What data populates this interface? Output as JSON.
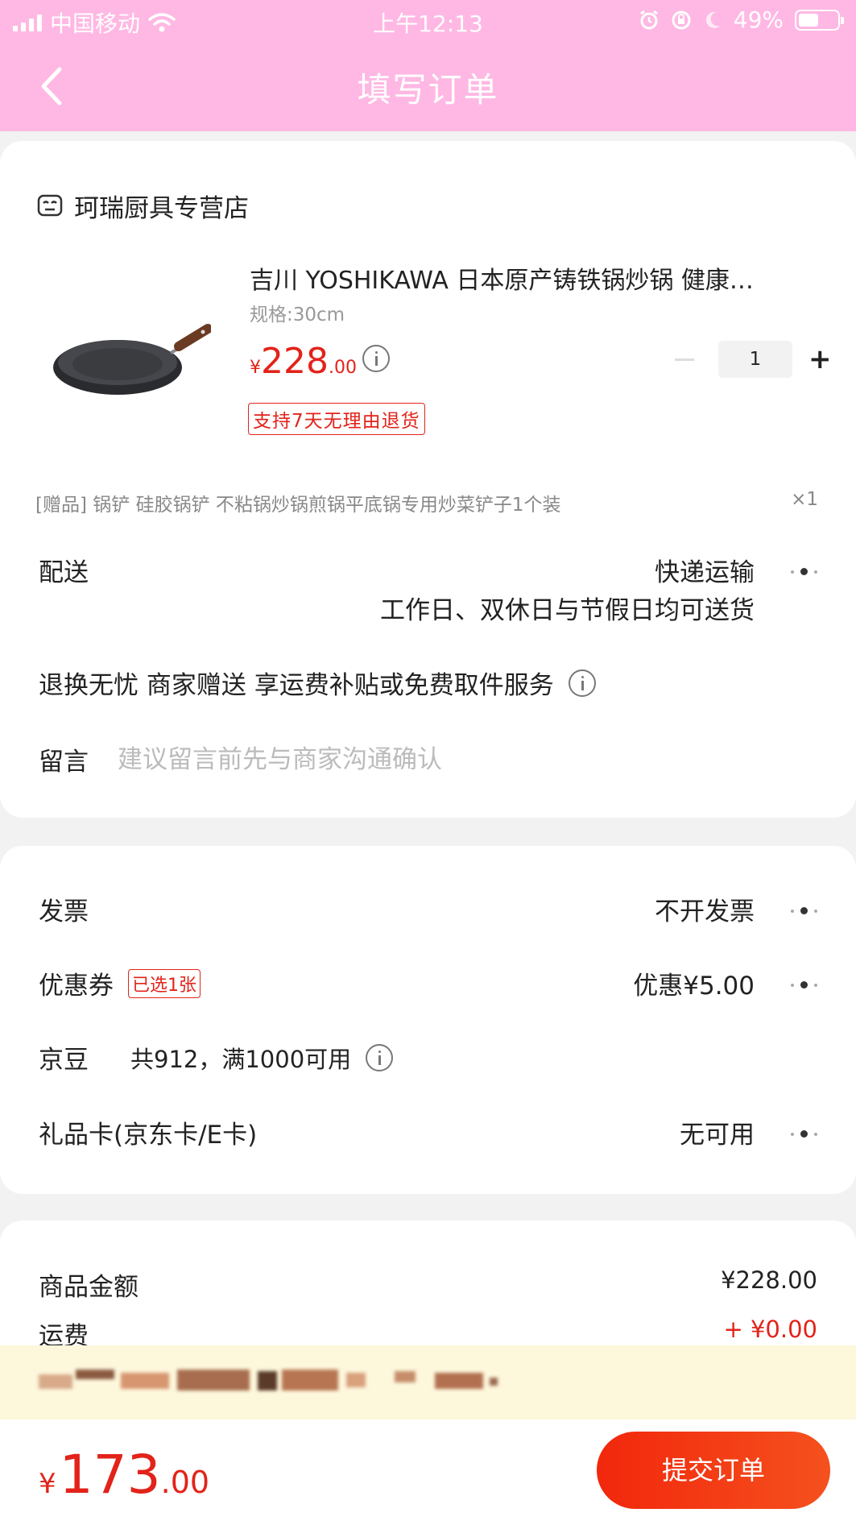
{
  "status_bar": {
    "carrier": "中国移动",
    "time": "上午12:13",
    "battery": "49%"
  },
  "nav": {
    "title": "填写订单"
  },
  "order": {
    "shop_name": "珂瑞厨具专营店",
    "product": {
      "title": "吉川 YOSHIKAWA 日本原产铸铁锅炒锅 健康…",
      "spec": "规格:30cm",
      "price_currency": "¥",
      "price_int": "228",
      "price_dec": ".00",
      "quantity": "1",
      "return_tag": "支持7天无理由退货"
    },
    "gift": {
      "text": "[赠品]  锅铲 硅胶锅铲 不粘锅炒锅煎锅平底锅专用炒菜铲子1个装",
      "count": "×1"
    },
    "delivery": {
      "label": "配送",
      "method": "快递运输",
      "detail": "工作日、双休日与节假日均可送货"
    },
    "service": {
      "text": "退换无忧 商家赠送 享运费补贴或免费取件服务"
    },
    "note": {
      "label": "留言",
      "placeholder": "建议留言前先与商家沟通确认"
    }
  },
  "payment": {
    "invoice": {
      "label": "发票",
      "value": "不开发票"
    },
    "coupon": {
      "label": "优惠券",
      "tag": "已选1张",
      "value": "优惠¥5.00"
    },
    "beans": {
      "label": "京豆",
      "text": "共912，满1000可用"
    },
    "gift_card": {
      "label": "礼品卡(京东卡/E卡)",
      "value": "无可用"
    }
  },
  "totals": {
    "goods_label": "商品金额",
    "goods_value": "¥228.00",
    "shipping_label": "运费",
    "shipping_value": "+ ¥0.00"
  },
  "bottom": {
    "currency": "¥",
    "price_int": "173",
    "price_dec": ".00",
    "submit_label": "提交订单"
  },
  "colors": {
    "header": "#ffb8e3",
    "accent_red": "#e2231a",
    "notice_bg": "#fdf7dc"
  }
}
